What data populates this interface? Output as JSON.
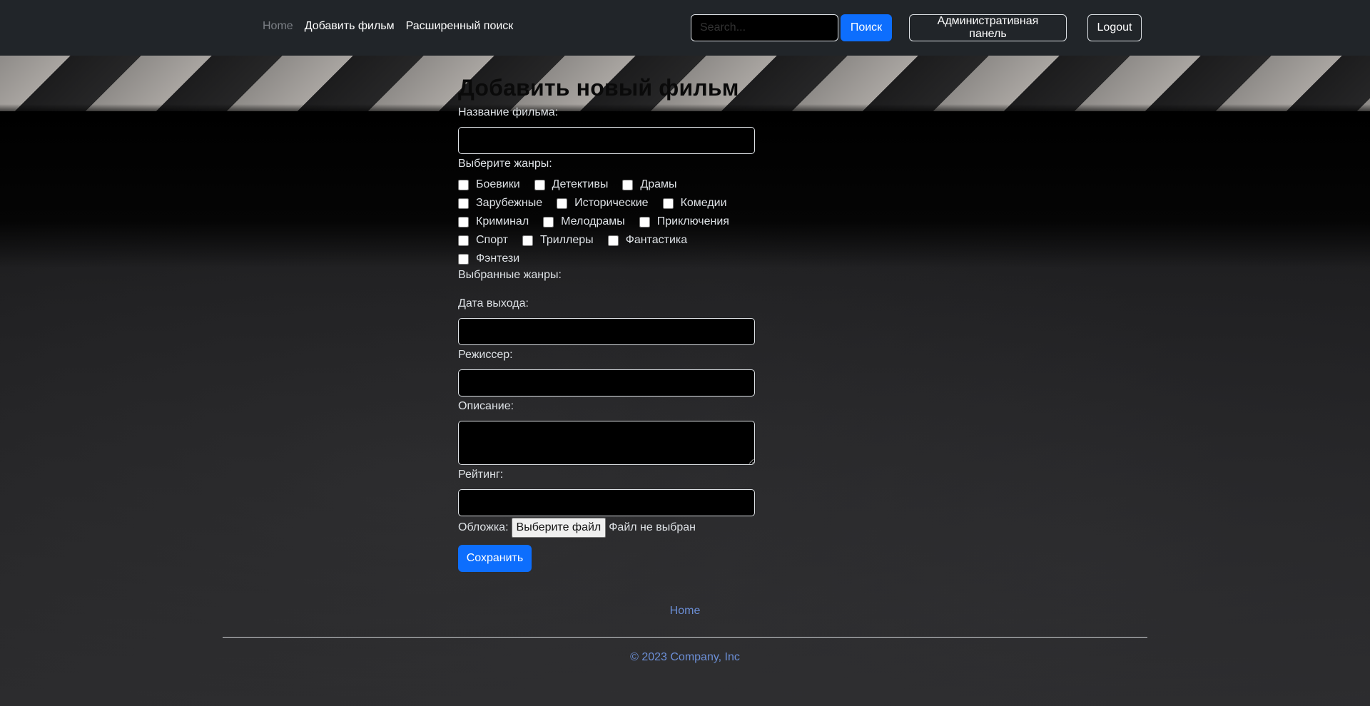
{
  "nav": {
    "links": [
      "Home",
      "Добавить фильм",
      "Расширенный поиск"
    ],
    "search_placeholder": "Search...",
    "search_button": "Поиск",
    "admin_button": "Административная панель",
    "logout_button": "Logout"
  },
  "form": {
    "title": "Добавить новый фильм",
    "name_label": "Название фильма:",
    "genres_label": "Выберите жанры:",
    "genres": [
      [
        "Боевики",
        "Детективы",
        "Драмы"
      ],
      [
        "Зарубежные",
        "Исторические",
        "Комедии"
      ],
      [
        "Криминал",
        "Мелодрамы",
        "Приключения"
      ],
      [
        "Спорт",
        "Триллеры",
        "Фантастика"
      ],
      [
        "Фэнтези"
      ]
    ],
    "selected_genres_label": "Выбранные жанры:",
    "release_label": "Дата выхода:",
    "director_label": "Режиссер:",
    "description_label": "Описание:",
    "rating_label": "Рейтинг:",
    "cover_label": "Обложка:",
    "file_button": "Выберите файл",
    "file_status": "Файл не выбран",
    "save_button": "Сохранить"
  },
  "footer": {
    "home_link": "Home",
    "copyright": "© 2023 Company, Inc"
  }
}
